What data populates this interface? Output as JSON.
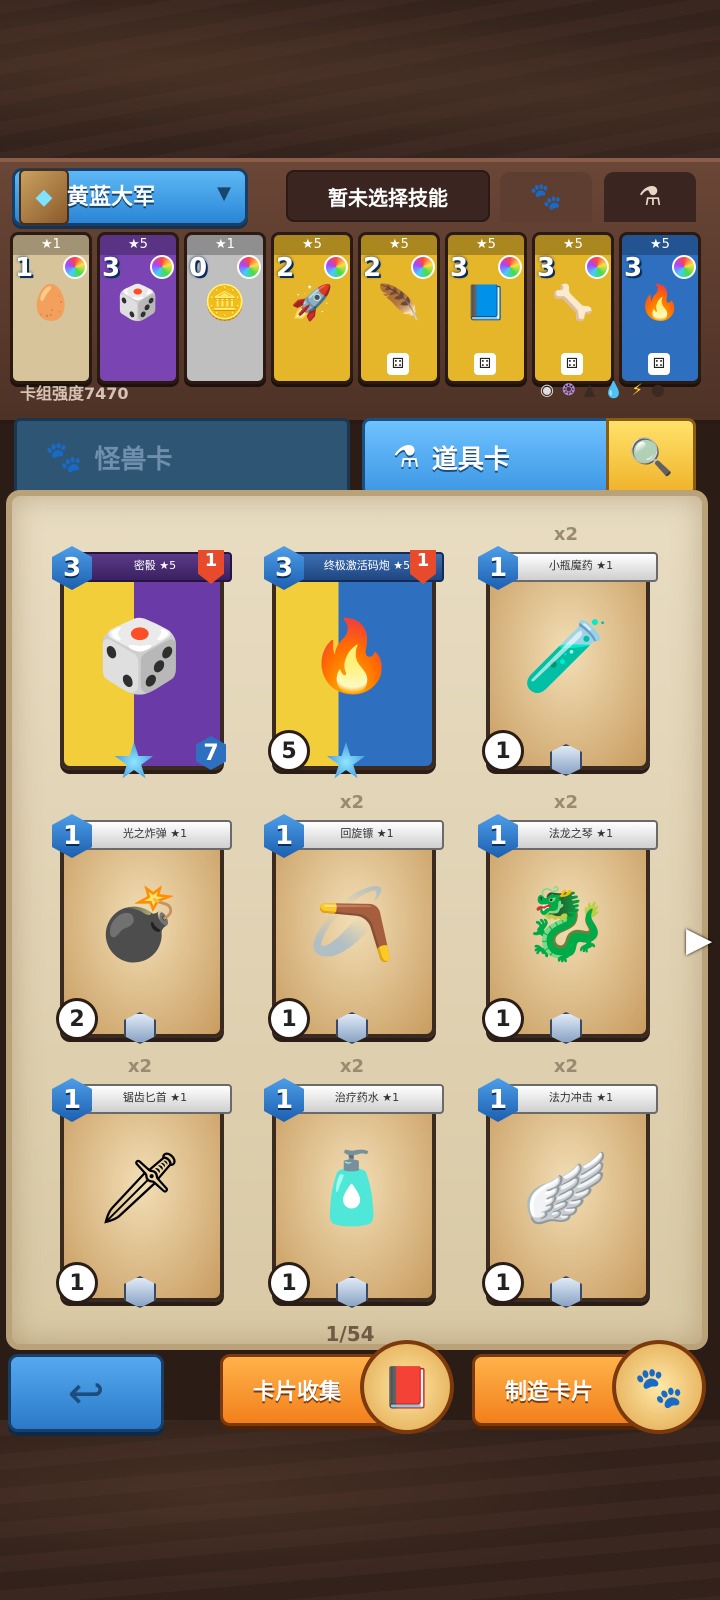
{
  "deck": {
    "name": "黄蓝大军",
    "skill_text": "暂未选择技能",
    "strength_label": "卡组强度7470"
  },
  "mini_cards": [
    {
      "stars": "★1",
      "cost": "1",
      "color": "#d8c49b",
      "art": "🥚"
    },
    {
      "stars": "★5",
      "cost": "3",
      "color": "#7a44b2",
      "art": "🎲"
    },
    {
      "stars": "★1",
      "cost": "0",
      "color": "#bfbfbf",
      "art": "🪙"
    },
    {
      "stars": "★5",
      "cost": "2",
      "color": "#e5b52a",
      "art": "🚀"
    },
    {
      "stars": "★5",
      "cost": "2",
      "color": "#e5b52a",
      "art": "🪶"
    },
    {
      "stars": "★5",
      "cost": "3",
      "color": "#e5b52a",
      "art": "📘"
    },
    {
      "stars": "★5",
      "cost": "3",
      "color": "#e5b52a",
      "art": "🦴"
    },
    {
      "stars": "★5",
      "cost": "3",
      "color": "#2f6fc0",
      "art": "🔥"
    }
  ],
  "tabs": {
    "monster": "怪兽卡",
    "item": "道具卡"
  },
  "cards": [
    {
      "dup": "",
      "cost": "3",
      "title": "密骰 ★5",
      "bl": "",
      "right": "7",
      "art": "🎲",
      "style": "purple",
      "flag": "1",
      "banner": "dark"
    },
    {
      "dup": "",
      "cost": "3",
      "title": "终极激活码炮 ★5",
      "bl": "5",
      "right": "",
      "art": "🔥",
      "style": "blue",
      "flag": "1",
      "banner": "blue-b"
    },
    {
      "dup": "x2",
      "cost": "1",
      "title": "小瓶魔药 ★1",
      "bl": "1",
      "right": "",
      "art": "🧪",
      "style": "",
      "flag": "",
      "banner": ""
    },
    {
      "dup": "",
      "cost": "1",
      "title": "光之炸弹 ★1",
      "bl": "2",
      "right": "",
      "art": "💣",
      "style": "",
      "flag": "",
      "banner": ""
    },
    {
      "dup": "x2",
      "cost": "1",
      "title": "回旋镖 ★1",
      "bl": "1",
      "right": "",
      "art": "🪃",
      "style": "",
      "flag": "",
      "banner": ""
    },
    {
      "dup": "x2",
      "cost": "1",
      "title": "法龙之琴 ★1",
      "bl": "1",
      "right": "",
      "art": "🐉",
      "style": "",
      "flag": "",
      "banner": ""
    },
    {
      "dup": "x2",
      "cost": "1",
      "title": "锯齿匕首 ★1",
      "bl": "1",
      "right": "",
      "art": "🗡",
      "style": "",
      "flag": "",
      "banner": ""
    },
    {
      "dup": "x2",
      "cost": "1",
      "title": "治疗药水 ★1",
      "bl": "1",
      "right": "",
      "art": "🧴",
      "style": "",
      "flag": "",
      "banner": ""
    },
    {
      "dup": "x2",
      "cost": "1",
      "title": "法力冲击 ★1",
      "bl": "1",
      "right": "",
      "art": "🪽",
      "style": "",
      "flag": "",
      "banner": ""
    }
  ],
  "pagination": "1/54",
  "buttons": {
    "collect": "卡片收集",
    "craft": "制造卡片"
  },
  "icons": {
    "paw": "🐾",
    "flask": "⚗",
    "search": "🔍",
    "back": "↩",
    "next": "▶"
  }
}
